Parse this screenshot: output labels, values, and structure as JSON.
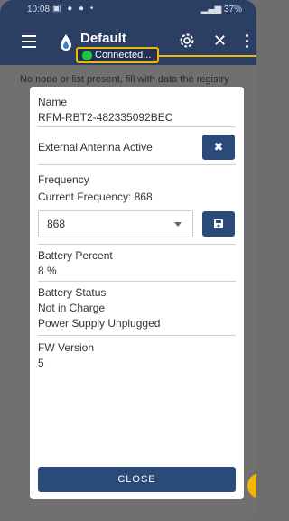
{
  "status_bar": {
    "time": "10:08",
    "right": "37%"
  },
  "app_bar": {
    "title": "Default",
    "connection_status": "Connected...",
    "status_color": "#22c43a",
    "highlight_color": "#f2b705"
  },
  "notice": "No node or list present, fill with data the registry",
  "dialog": {
    "name_label": "Name",
    "name_value": "RFM-RBT2-482335092BEC",
    "antenna_label": "External Antenna Active",
    "antenna_button": "✖",
    "frequency_label": "Frequency",
    "current_frequency": "Current Frequency: 868",
    "frequency_select_value": "868",
    "save_icon": "save-icon",
    "battery_percent_label": "Battery Percent",
    "battery_percent_value": "8 %",
    "battery_status_label": "Battery Status",
    "battery_status_charge": "Not in Charge",
    "battery_status_supply": "Power Supply Unplugged",
    "fw_label": "FW Version",
    "fw_value": "5",
    "close_button": "CLOSE"
  },
  "colors": {
    "appbar": "#2a3f63",
    "button": "#2a4a7a"
  }
}
